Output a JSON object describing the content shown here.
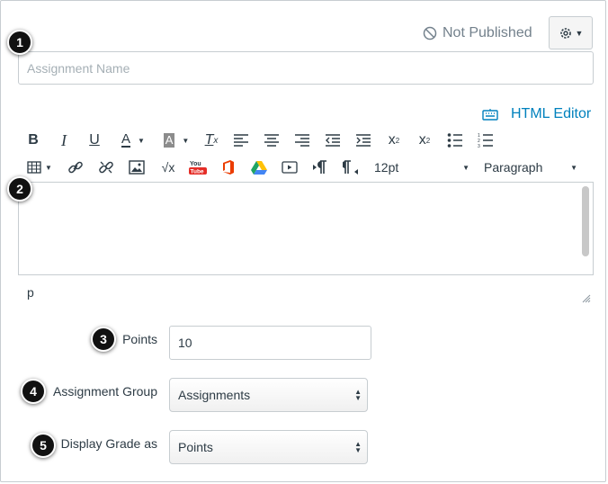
{
  "header": {
    "status_label": "Not Published",
    "settings_icon": "gear-icon"
  },
  "assignment_name": {
    "value": "",
    "placeholder": "Assignment Name"
  },
  "editor": {
    "html_editor_label": "HTML Editor",
    "toolbar_row1": [
      "bold-icon",
      "italic-icon",
      "underline-icon",
      "text-color-icon",
      "background-color-icon",
      "clear-formatting-icon",
      "align-left-icon",
      "align-center-icon",
      "align-right-icon",
      "outdent-icon",
      "indent-icon",
      "superscript-icon",
      "subscript-icon",
      "bullet-list-icon",
      "numbered-list-icon"
    ],
    "toolbar_row2": [
      "table-icon",
      "link-icon",
      "unlink-icon",
      "image-icon",
      "math-icon",
      "youtube-icon",
      "office-icon",
      "google-drive-icon",
      "media-icon",
      "ltr-icon",
      "rtl-icon"
    ],
    "font_size": "12pt",
    "block_format": "Paragraph",
    "path_label": "p"
  },
  "badges": [
    "1",
    "2",
    "3",
    "4",
    "5"
  ],
  "form": {
    "points_label": "Points",
    "points_value": "10",
    "group_label": "Assignment Group",
    "group_value": "Assignments",
    "display_grade_label": "Display Grade as",
    "display_grade_value": "Points"
  },
  "colors": {
    "link": "#0081bd",
    "muted": "#73818c",
    "border": "#c7cdd1",
    "text": "#2d3b45"
  }
}
